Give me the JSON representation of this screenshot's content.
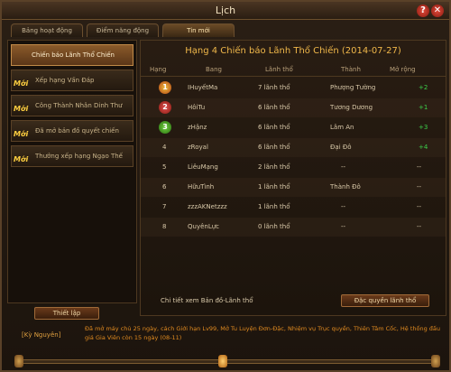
{
  "window": {
    "title": "Lịch"
  },
  "tabs": [
    {
      "label": "Bảng hoạt động"
    },
    {
      "label": "Điểm năng động"
    },
    {
      "label": "Tin mới"
    }
  ],
  "sidebar": {
    "items": [
      {
        "label": "Chiến báo Lãnh Thổ Chiến",
        "badge": ""
      },
      {
        "label": "Xếp hạng Vấn Đáp",
        "badge": "Mới"
      },
      {
        "label": "Công Thành Nhân Dinh Thư",
        "badge": "Mới"
      },
      {
        "label": "Đã mở bản đồ quyết chiến",
        "badge": "Mới"
      },
      {
        "label": "Thưởng xếp hạng Ngạo Thế",
        "badge": "Mới"
      }
    ],
    "setup_button": "Thiết lập"
  },
  "main": {
    "title": "Hạng 4 Chiến báo Lãnh Thổ Chiến (2014-07-27)",
    "headers": {
      "rank": "Hạng",
      "guild": "Bang",
      "territory": "Lãnh thổ",
      "city": "Thành",
      "expand": "Mở rộng"
    },
    "rows": [
      {
        "rank": "1",
        "guild": "IHuyếtMa",
        "territory": "7 lãnh thổ",
        "city": "Phượng Tường",
        "expand": "+2"
      },
      {
        "rank": "2",
        "guild": "HôiTu",
        "territory": "6 lãnh thổ",
        "city": "Tương Dương",
        "expand": "+1"
      },
      {
        "rank": "3",
        "guild": "zHậnz",
        "territory": "6 lãnh thổ",
        "city": "Lâm An",
        "expand": "+3"
      },
      {
        "rank": "4",
        "guild": "zRoyal",
        "territory": "6 lãnh thổ",
        "city": "Đại Đô",
        "expand": "+4"
      },
      {
        "rank": "5",
        "guild": "LiêuMạng",
        "territory": "2 lãnh thổ",
        "city": "--",
        "expand": "--"
      },
      {
        "rank": "6",
        "guild": "HữuTình",
        "territory": "1 lãnh thổ",
        "city": "Thành Đô",
        "expand": "--"
      },
      {
        "rank": "7",
        "guild": "zzzAKNetzzz",
        "territory": "1 lãnh thổ",
        "city": "--",
        "expand": "--"
      },
      {
        "rank": "8",
        "guild": "QuyênLực",
        "territory": "0 lãnh thổ",
        "city": "--",
        "expand": "--"
      }
    ],
    "detail_text": "Chi tiết xem Bản đồ-Lãnh thổ",
    "privilege_button": "Đặc quyền lãnh thổ"
  },
  "news": {
    "tag": "[Kỳ Nguyên]",
    "text": "Đã mở máy chủ 25 ngày, cách Giới hạn Lv99, Mở Tu Luyện Đơn-Đặc, Nhiệm vụ Trục quyền, Thiên Tâm Cốc, Hệ thống đấu giá Gia Viên còn 15 ngày (08-11)"
  },
  "colors": {
    "accent": "#f0b84a",
    "positive": "#3cd04a",
    "news": "#e08a20"
  }
}
